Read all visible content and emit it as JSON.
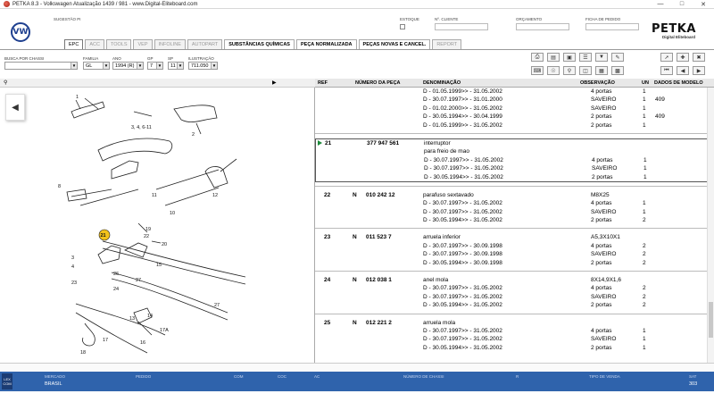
{
  "window": {
    "title": "PETKA 8.3 - Volkswagen Atualização 1439 / 981 - www.Digital-Eliteboard.com"
  },
  "header": {
    "fields": [
      {
        "label": "SUGESTÃO PI"
      },
      {
        "label": "ESTOQUE"
      },
      {
        "label": "Nº. CLIENTE"
      },
      {
        "label": "ORÇAMENTO"
      },
      {
        "label": "FICHA DE PEDIDO"
      }
    ],
    "brand": "PETKA",
    "brand_sub": "Digital Eliteboard"
  },
  "tabs": [
    {
      "label": "EPC",
      "state": "active"
    },
    {
      "label": "ACC",
      "state": "disabled"
    },
    {
      "label": "TOOLS",
      "state": "disabled"
    },
    {
      "label": "VEP",
      "state": "disabled"
    },
    {
      "label": "INFOLINE",
      "state": "disabled"
    },
    {
      "label": "AUTOPART",
      "state": "disabled"
    },
    {
      "label": "SUBSTÂNCIAS QUÍMICAS",
      "state": "enabled"
    },
    {
      "label": "PEÇA NORMALIZADA",
      "state": "enabled"
    },
    {
      "label": "PEÇAS NOVAS E CANCEL.",
      "state": "enabled"
    },
    {
      "label": "REPORT",
      "state": "disabled"
    }
  ],
  "filters": {
    "chassis_label": "BUSCA POR CHASSI",
    "chassis_value": "",
    "family_label": "FAMILIA",
    "family_value": "GL",
    "year_label": "ANO",
    "year_value": "1994 (R)",
    "gp_label": "GP",
    "gp_value": "7",
    "sp_label": "SP",
    "sp_value": "11",
    "illustration_label": "ILUSTRAÇÃO",
    "illustration_value": "711.050"
  },
  "table": {
    "headers": {
      "ref": "REF",
      "part_no": "NÚMERO DA PEÇA",
      "desc": "DENOMINAÇÃO",
      "obs": "OBSERVAÇÃO",
      "un": "UN",
      "model": "DADOS DE MODELO"
    },
    "groups": [
      {
        "ref": "",
        "prefix": "",
        "part_no": "",
        "selected": false,
        "lines": [
          {
            "desc": "D - 01.05.1999>> - 31.05.2002",
            "obs": "4 portas",
            "un": "1",
            "model": ""
          },
          {
            "desc": "D - 30.07.1997>> - 31.01.2000",
            "obs": "SAVEIRO",
            "un": "1",
            "model": "409"
          },
          {
            "desc": "D - 01.02.2000>> - 31.05.2002",
            "obs": "SAVEIRO",
            "un": "1",
            "model": ""
          },
          {
            "desc": "D - 30.05.1994>> - 30.04.1999",
            "obs": "2 portas",
            "un": "1",
            "model": "409"
          },
          {
            "desc": "D - 01.05.1999>> - 31.05.2002",
            "obs": "2 portas",
            "un": "1",
            "model": ""
          }
        ]
      },
      {
        "ref": "21",
        "prefix": "",
        "part_no": "377 947 561",
        "selected": true,
        "lines": [
          {
            "desc": "interruptor",
            "obs": "",
            "un": "",
            "model": ""
          },
          {
            "desc": "para freio de mao",
            "obs": "",
            "un": "",
            "model": ""
          },
          {
            "desc": "D - 30.07.1997>> - 31.05.2002",
            "obs": "4 portas",
            "un": "1",
            "model": ""
          },
          {
            "desc": "D - 30.07.1997>> - 31.05.2002",
            "obs": "SAVEIRO",
            "un": "1",
            "model": ""
          },
          {
            "desc": "D - 30.05.1994>> - 31.05.2002",
            "obs": "2 portas",
            "un": "1",
            "model": ""
          }
        ]
      },
      {
        "ref": "22",
        "prefix": "N",
        "part_no": "010 242 12",
        "selected": false,
        "lines": [
          {
            "desc": "parafuso sextavado",
            "obs": "M8X25",
            "un": "",
            "model": ""
          },
          {
            "desc": "D - 30.07.1997>> - 31.05.2002",
            "obs": "4 portas",
            "un": "1",
            "model": ""
          },
          {
            "desc": "D - 30.07.1997>> - 31.05.2002",
            "obs": "SAVEIRO",
            "un": "1",
            "model": ""
          },
          {
            "desc": "D - 30.05.1994>> - 31.05.2002",
            "obs": "2 portas",
            "un": "2",
            "model": ""
          }
        ]
      },
      {
        "ref": "23",
        "prefix": "N",
        "part_no": "011 523 7",
        "selected": false,
        "lines": [
          {
            "desc": "arruela inferior",
            "obs": "A5,3X10X1",
            "un": "",
            "model": ""
          },
          {
            "desc": "D - 30.07.1997>> - 30.09.1998",
            "obs": "4 portas",
            "un": "2",
            "model": ""
          },
          {
            "desc": "D - 30.07.1997>> - 30.09.1998",
            "obs": "SAVEIRO",
            "un": "2",
            "model": ""
          },
          {
            "desc": "D - 30.05.1994>> - 30.09.1998",
            "obs": "2 portas",
            "un": "2",
            "model": ""
          }
        ]
      },
      {
        "ref": "24",
        "prefix": "N",
        "part_no": "012 038 1",
        "selected": false,
        "lines": [
          {
            "desc": "anel mola",
            "obs": "8X14,9X1,6",
            "un": "",
            "model": ""
          },
          {
            "desc": "D - 30.07.1997>> - 31.05.2002",
            "obs": "4 portas",
            "un": "2",
            "model": ""
          },
          {
            "desc": "D - 30.07.1997>> - 31.05.2002",
            "obs": "SAVEIRO",
            "un": "2",
            "model": ""
          },
          {
            "desc": "D - 30.05.1994>> - 31.05.2002",
            "obs": "2 portas",
            "un": "2",
            "model": ""
          }
        ]
      },
      {
        "ref": "25",
        "prefix": "N",
        "part_no": "012 221 2",
        "selected": false,
        "lines": [
          {
            "desc": "arruela mola",
            "obs": "",
            "un": "",
            "model": ""
          },
          {
            "desc": "D - 30.07.1997>> - 31.05.2002",
            "obs": "4 portas",
            "un": "1",
            "model": ""
          },
          {
            "desc": "D - 30.07.1997>> - 31.05.2002",
            "obs": "SAVEIRO",
            "un": "1",
            "model": ""
          },
          {
            "desc": "D - 30.05.1994>> - 31.05.2002",
            "obs": "2 portas",
            "un": "1",
            "model": ""
          }
        ]
      }
    ]
  },
  "diagram": {
    "callouts": [
      "1",
      "2",
      "3, 4, 6-11",
      "5",
      "8",
      "9",
      "10",
      "11",
      "12",
      "13",
      "14",
      "15",
      "16",
      "17",
      "17A",
      "18",
      "19",
      "20",
      "21",
      "22",
      "23",
      "24",
      "25",
      "26",
      "27",
      "3",
      "4",
      "5"
    ]
  },
  "statusbar": {
    "badge": "LEX COM",
    "fields": [
      {
        "label": "MERCADO",
        "value": "BRASIL"
      },
      {
        "label": "PEDIDO",
        "value": ""
      },
      {
        "label": "COM",
        "value": ""
      },
      {
        "label": "COC",
        "value": ""
      },
      {
        "label": "AC",
        "value": ""
      },
      {
        "label": "NÚMERO DE CHASSI",
        "value": ""
      },
      {
        "label": "R",
        "value": ""
      },
      {
        "label": "TIPO DE VENDA",
        "value": ""
      },
      {
        "label": "SAT",
        "value": "303"
      }
    ]
  },
  "colors": {
    "statusbar": "#2f63ac",
    "selected_marker": "#1d8a3a",
    "callout_highlight": "#f2c21b"
  }
}
